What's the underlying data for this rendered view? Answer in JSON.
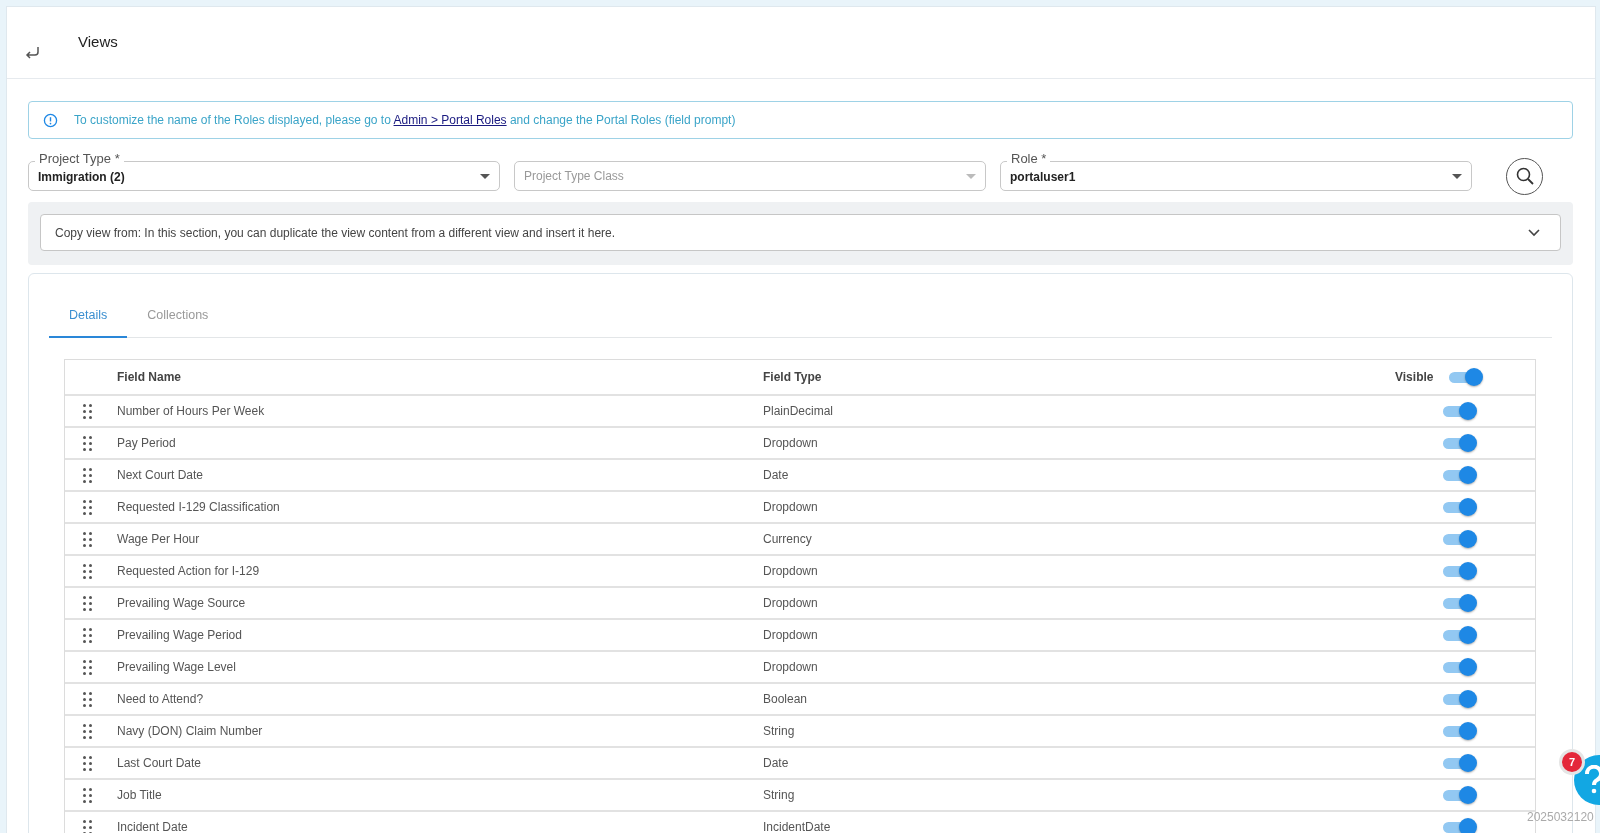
{
  "header": {
    "title": "Views"
  },
  "info": {
    "before": "To customize the name of the Roles displayed, please go to",
    "link": "Admin > Portal Roles",
    "after": "and change the Portal Roles (field prompt)"
  },
  "filters": [
    {
      "label": "Project Type *",
      "value": "Immigration (2)"
    },
    {
      "placeholder": "Project Type Class"
    },
    {
      "label": "Role *",
      "value": "portaluser1"
    }
  ],
  "copy_view": {
    "text": "Copy view from: In this section, you can duplicate the view content from a different view and insert it here.",
    "expanded": false
  },
  "tabs": [
    {
      "label": "Details",
      "selected": true
    },
    {
      "label": "Collections",
      "selected": false
    }
  ],
  "table": {
    "columns": [
      "Field Name",
      "Field Type",
      "Visible"
    ],
    "all_visible": true,
    "rows": [
      {
        "name": "Number of Hours Per Week",
        "type": "PlainDecimal",
        "visible": true
      },
      {
        "name": "Pay Period",
        "type": "Dropdown",
        "visible": true
      },
      {
        "name": "Next Court Date",
        "type": "Date",
        "visible": true
      },
      {
        "name": "Requested I-129 Classification",
        "type": "Dropdown",
        "visible": true
      },
      {
        "name": "Wage Per Hour",
        "type": "Currency",
        "visible": true
      },
      {
        "name": "Requested Action for I-129",
        "type": "Dropdown",
        "visible": true
      },
      {
        "name": "Prevailing Wage Source",
        "type": "Dropdown",
        "visible": true
      },
      {
        "name": "Prevailing Wage Period",
        "type": "Dropdown",
        "visible": true
      },
      {
        "name": "Prevailing Wage Level",
        "type": "Dropdown",
        "visible": true
      },
      {
        "name": "Need to Attend?",
        "type": "Boolean",
        "visible": true
      },
      {
        "name": "Navy (DON) Claim Number",
        "type": "String",
        "visible": true
      },
      {
        "name": "Last Court Date",
        "type": "Date",
        "visible": true
      },
      {
        "name": "Job Title",
        "type": "String",
        "visible": true
      },
      {
        "name": "Incident Date",
        "type": "IncidentDate",
        "visible": true
      }
    ]
  },
  "help": {
    "badge": "7"
  },
  "build_stamp": "2025032120"
}
